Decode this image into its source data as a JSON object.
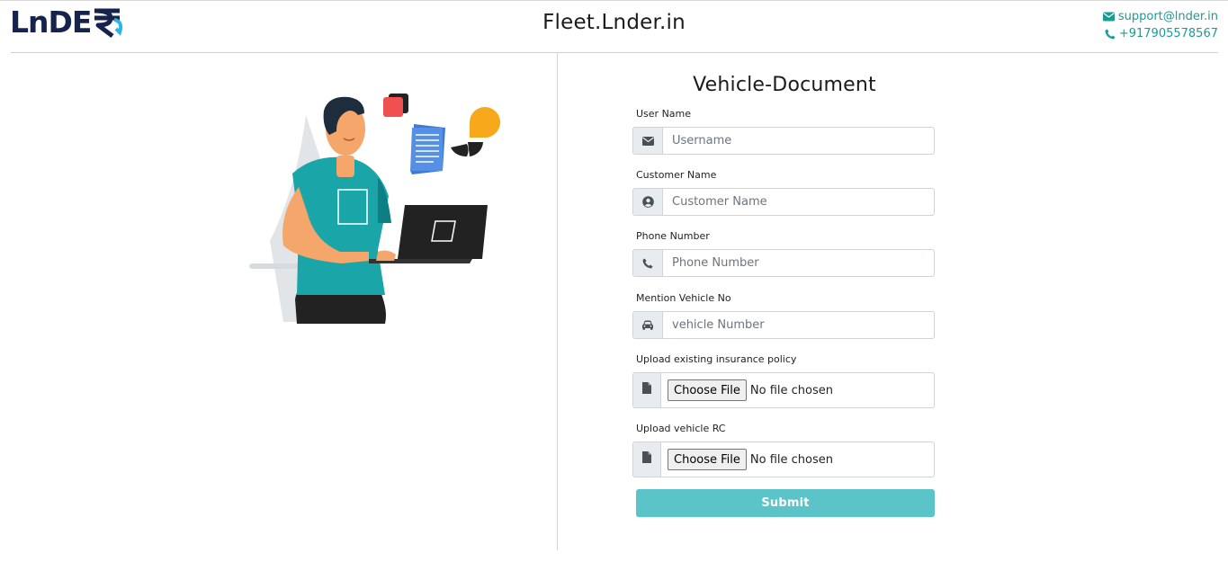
{
  "header": {
    "logo_text": "LnDE",
    "site_title": "Fleet.Lnder.in",
    "email": "support@lnder.in",
    "phone": "+917905578567"
  },
  "form": {
    "title": "Vehicle-Document",
    "fields": {
      "username": {
        "label": "User Name",
        "placeholder": "Username",
        "icon": "envelope-icon"
      },
      "customer": {
        "label": "Customer Name",
        "placeholder": "Customer Name",
        "icon": "user-circle-icon"
      },
      "phone": {
        "label": "Phone Number",
        "placeholder": "Phone Number",
        "icon": "phone-icon"
      },
      "vehicle": {
        "label": "Mention Vehicle No",
        "placeholder": "vehicle Number",
        "icon": "car-icon"
      },
      "insurance": {
        "label": "Upload existing insurance policy",
        "button": "Choose File",
        "status": "No file chosen",
        "icon": "file-icon"
      },
      "rc": {
        "label": "Upload vehicle RC",
        "button": "Choose File",
        "status": "No file chosen",
        "icon": "file-icon"
      }
    },
    "submit_label": "Submit"
  },
  "colors": {
    "accent": "#5bc4c9",
    "contact": "#1a9b96",
    "logo_dark": "#16244d",
    "logo_light": "#29b6e8"
  }
}
